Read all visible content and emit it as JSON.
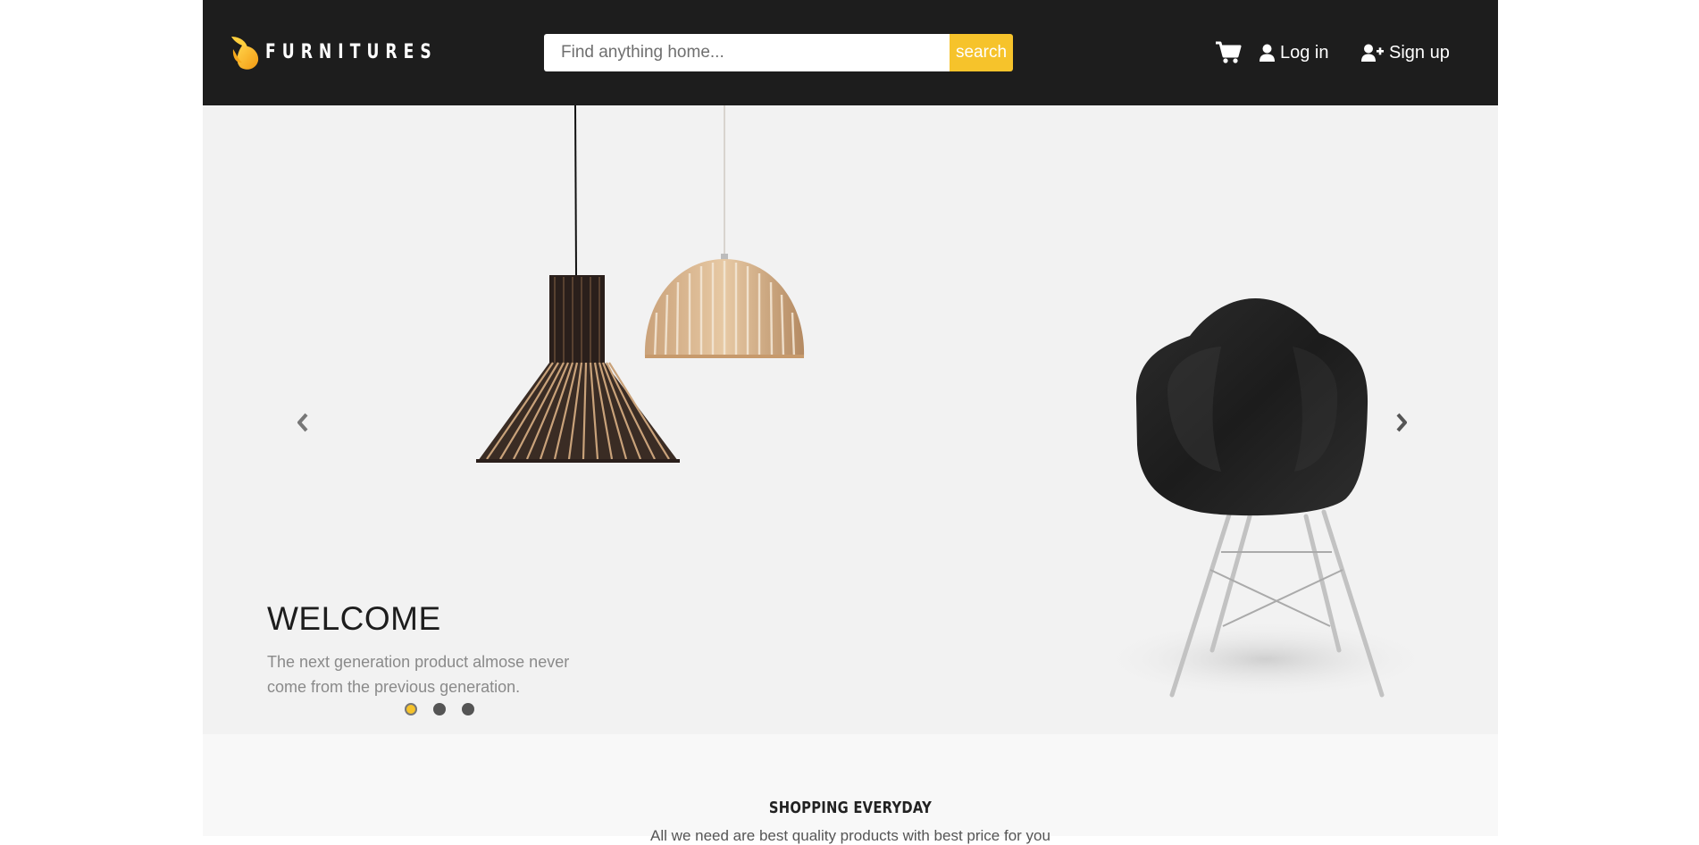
{
  "brand": {
    "name": "FURNITURES",
    "logo_icon": "leaf-icon",
    "accent_color": "#f6c32b",
    "header_bg": "#1d1d1d"
  },
  "search": {
    "placeholder": "Find anything home...",
    "value": "",
    "button_label": "search"
  },
  "nav": {
    "cart_icon": "cart-icon",
    "login_label": "Log in",
    "login_icon": "user-icon",
    "signup_label": "Sign up",
    "signup_icon": "user-plus-icon"
  },
  "hero": {
    "title": "WELCOME",
    "subtitle": "The next generation product almose never come from the previous generation.",
    "slides_count": 3,
    "active_slide": 1,
    "prev_icon": "chevron-left-icon",
    "next_icon": "chevron-right-icon",
    "bg_color": "#f2f2f2"
  },
  "section": {
    "title": "SHOPPING EVERYDAY",
    "text": "All we need are best quality products with best price for you"
  }
}
